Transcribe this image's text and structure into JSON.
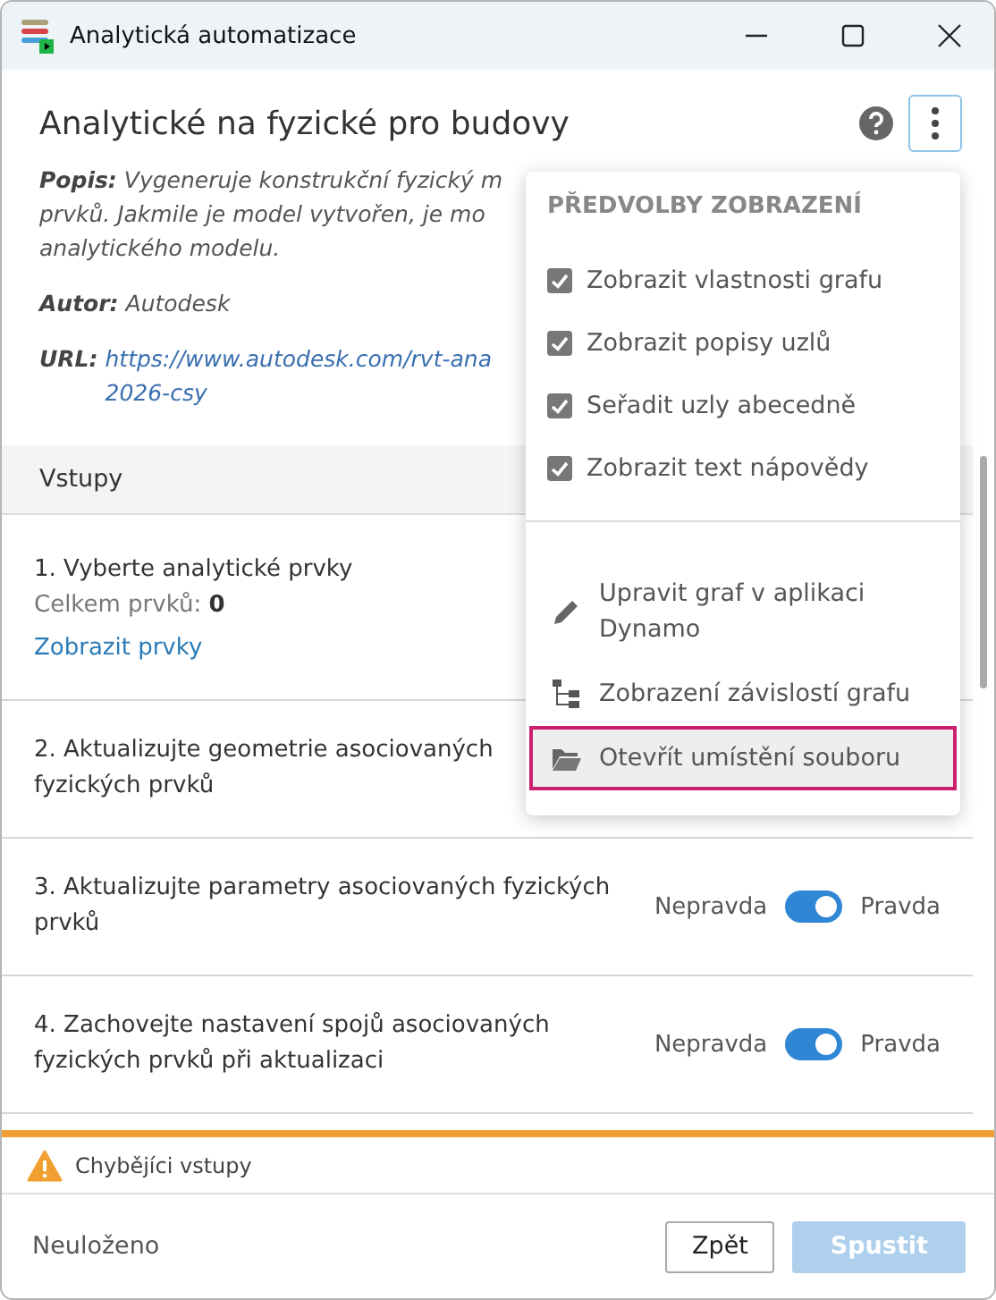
{
  "window": {
    "title": "Analytická automatizace"
  },
  "header": {
    "title": "Analytické na fyzické pro budovy",
    "description": {
      "label": "Popis:",
      "lines": [
        "Vygeneruje konstrukční fyzický m",
        "prvků. Jakmile je model vytvořen, je mo",
        "analytického modelu."
      ]
    },
    "author": {
      "label": "Autor:",
      "value": "Autodesk"
    },
    "url": {
      "label": "URL:",
      "lines": [
        "https://www.autodesk.com/rvt-ana",
        "2026-csy"
      ]
    }
  },
  "menu": {
    "heading": "PŘEDVOLBY ZOBRAZENÍ",
    "options": [
      {
        "label": "Zobrazit vlastnosti grafu",
        "checked": true
      },
      {
        "label": "Zobrazit popisy uzlů",
        "checked": true
      },
      {
        "label": "Seřadit uzly abecedně",
        "checked": true
      },
      {
        "label": "Zobrazit text nápovědy",
        "checked": true
      }
    ],
    "actions": [
      {
        "label": "Upravit graf v aplikaci Dynamo",
        "selected": false
      },
      {
        "label": "Zobrazení závislostí grafu",
        "selected": false
      },
      {
        "label": "Otevřít umístění souboru",
        "selected": true
      }
    ]
  },
  "inputs_section": {
    "title": "Vstupy"
  },
  "inputs": [
    {
      "kind": "selection",
      "label": "1. Vyberte analytické prvky",
      "count": "Celkem prvků: **0**",
      "link": "Zobrazit prvky"
    },
    {
      "kind": "plain",
      "label": "2. Aktualizujte geometrie asociovaných fyzických prvků"
    },
    {
      "kind": "toggle",
      "label": "3. Aktualizujte parametry asociovaných fyzických prvků",
      "off_label": "Nepravda",
      "on_label": "Pravda",
      "on": true
    },
    {
      "kind": "toggle",
      "label": "4. Zachovejte nastavení spojů asociovaných fyzických prvků při aktualizaci",
      "off_label": "Nepravda",
      "on_label": "Pravda",
      "on": true
    }
  ],
  "warning": {
    "text": "Chybějíci vstupy"
  },
  "footer": {
    "status": "Neuloženo",
    "buttons": [
      {
        "label": "Zpět",
        "disabled": false
      },
      {
        "label": "Spustit",
        "disabled": true
      }
    ]
  }
}
